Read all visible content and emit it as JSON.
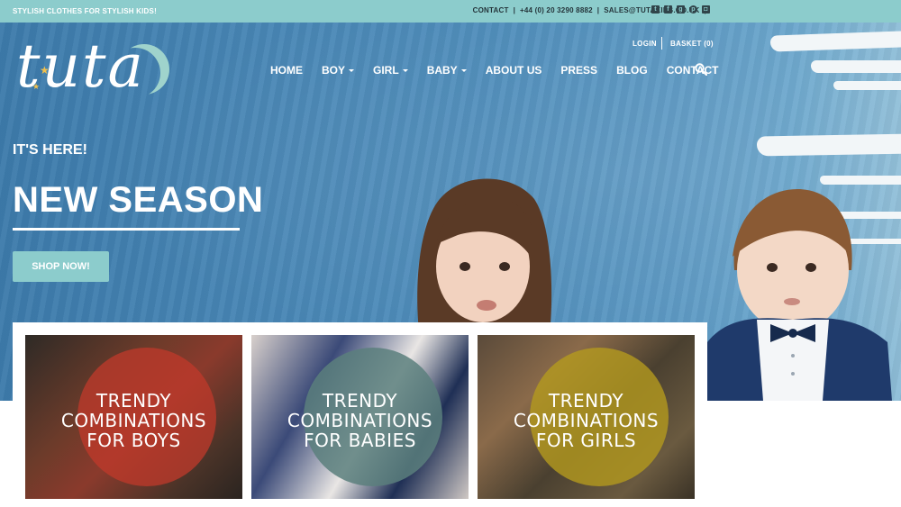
{
  "topbar": {
    "tagline": "STYLISH CLOTHES FOR STYLISH KIDS!",
    "contact_label": "CONTACT",
    "phone": "+44 (0) 20 3290 8882",
    "email": "SALES@TUTAKIDS.CO.UK",
    "social_icons": [
      "twitter-icon",
      "facebook-icon",
      "google-plus-icon",
      "pinterest-icon",
      "instagram-icon"
    ]
  },
  "header": {
    "logo_text": "tuta",
    "login": "LOGIN",
    "basket": "BASKET (0)",
    "nav": [
      {
        "label": "HOME",
        "dropdown": false
      },
      {
        "label": "BOY",
        "dropdown": true
      },
      {
        "label": "GIRL",
        "dropdown": true
      },
      {
        "label": "BABY",
        "dropdown": true
      },
      {
        "label": "ABOUT US",
        "dropdown": false
      },
      {
        "label": "PRESS",
        "dropdown": false
      },
      {
        "label": "BLOG",
        "dropdown": false
      },
      {
        "label": "CONTACT",
        "dropdown": false
      }
    ]
  },
  "hero": {
    "eyebrow": "IT'S HERE!",
    "headline": "NEW SEASON",
    "cta": "SHOP NOW!"
  },
  "categories": [
    {
      "line1": "TRENDY",
      "line2": "COMBINATIONS",
      "line3": "FOR BOYS",
      "circle_color": "#c0392b"
    },
    {
      "line1": "TRENDY",
      "line2": "COMBINATIONS",
      "line3": "FOR BABIES",
      "circle_color": "#5b7f7c"
    },
    {
      "line1": "TRENDY",
      "line2": "COMBINATIONS",
      "line3": "FOR GIRLS",
      "circle_color": "#b49a1e"
    }
  ],
  "colors": {
    "topbar": "#8ccccc",
    "hero_blue": "#4886b5",
    "accent_teal": "#8ccccc"
  }
}
